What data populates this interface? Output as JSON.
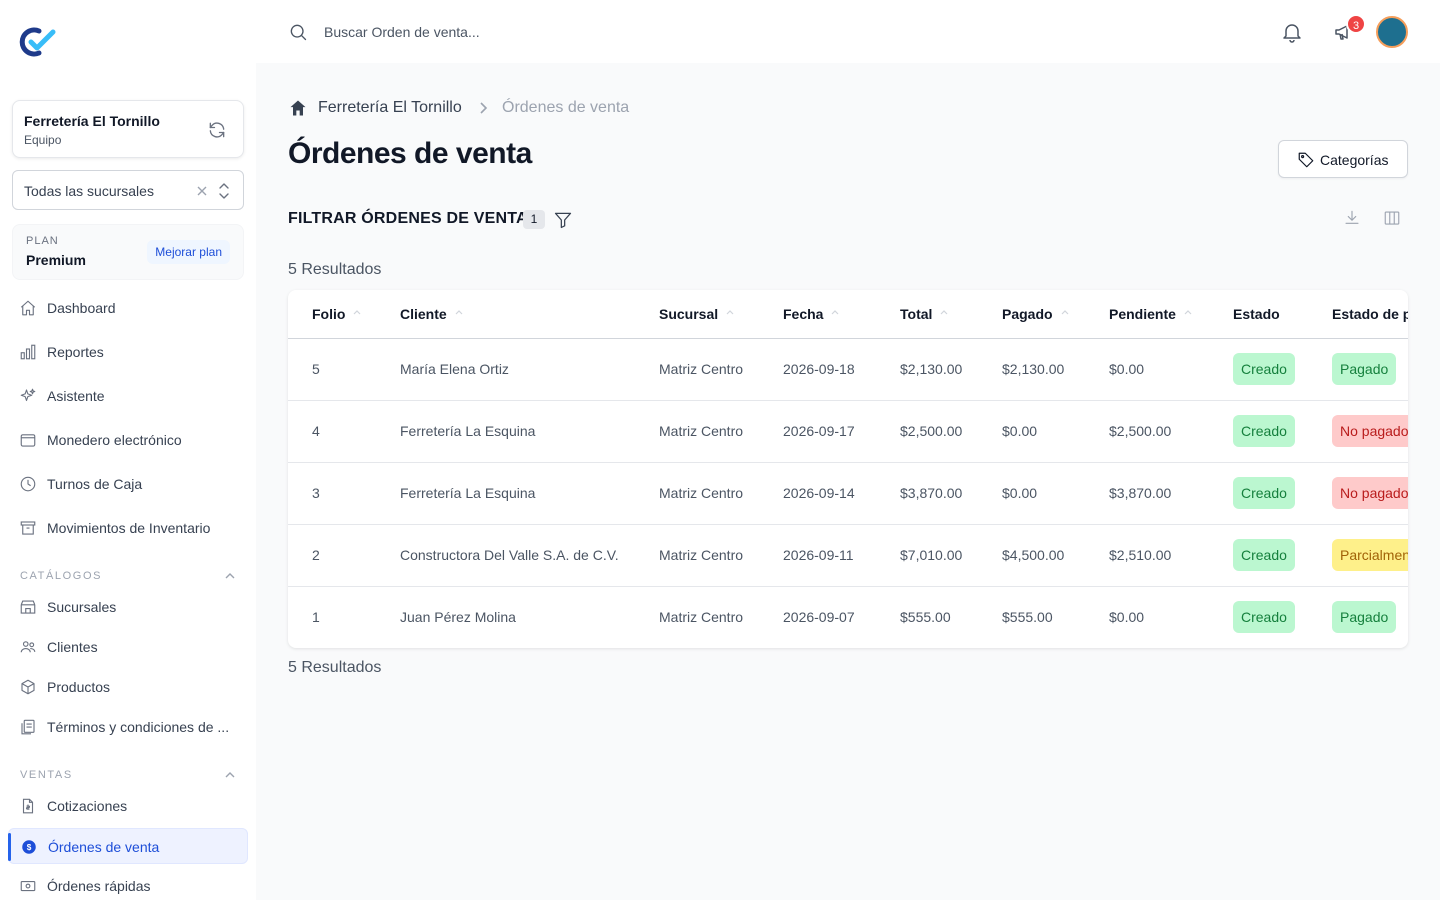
{
  "search": {
    "placeholder": "Buscar Orden de venta..."
  },
  "notifications": {
    "badge_count": "3"
  },
  "organization": {
    "name": "Ferretería El Tornillo",
    "subtitle": "Equipo"
  },
  "branch_select": {
    "value": "Todas las sucursales"
  },
  "plan": {
    "label": "PLAN",
    "name": "Premium",
    "upgrade_label": "Mejorar plan"
  },
  "sidebar": {
    "main_items": [
      {
        "label": "Dashboard",
        "icon": "home-icon"
      },
      {
        "label": "Reportes",
        "icon": "chart-icon"
      },
      {
        "label": "Asistente",
        "icon": "sparkles-icon"
      },
      {
        "label": "Monedero electrónico",
        "icon": "wallet-icon"
      },
      {
        "label": "Turnos de Caja",
        "icon": "clock-icon"
      },
      {
        "label": "Movimientos de Inventario",
        "icon": "archive-icon"
      }
    ],
    "catalogs_label": "CATÁLOGOS",
    "catalog_items": [
      {
        "label": "Sucursales",
        "icon": "store-icon"
      },
      {
        "label": "Clientes",
        "icon": "users-icon"
      },
      {
        "label": "Productos",
        "icon": "cube-icon"
      },
      {
        "label": "Términos y condiciones de ...",
        "icon": "documents-icon"
      }
    ],
    "sales_label": "VENTAS",
    "sales_items": [
      {
        "label": "Cotizaciones",
        "icon": "document-dollar-icon"
      },
      {
        "label": "Órdenes de venta",
        "icon": "dollar-circle-icon",
        "active": true
      },
      {
        "label": "Órdenes rápidas",
        "icon": "cash-icon"
      }
    ]
  },
  "breadcrumb": {
    "root": "Ferretería El Tornillo",
    "current": "Órdenes de venta"
  },
  "page": {
    "title": "Órdenes de venta",
    "categories_button": "Categorías",
    "filter_title": "FILTRAR ÓRDENES DE VENTA",
    "filter_count": "1",
    "results_label": "5 Resultados"
  },
  "table": {
    "columns": [
      "Folio",
      "Cliente",
      "Sucursal",
      "Fecha",
      "Total",
      "Pagado",
      "Pendiente",
      "Estado",
      "Estado de pago"
    ],
    "rows": [
      {
        "folio": "5",
        "cliente": "María Elena Ortiz",
        "sucursal": "Matriz Centro",
        "fecha": "2026-09-18",
        "total": "$2,130.00",
        "pagado": "$2,130.00",
        "pendiente": "$0.00",
        "estado": "Creado",
        "estado_pago": "Pagado",
        "pago_color": "green"
      },
      {
        "folio": "4",
        "cliente": "Ferretería La Esquina",
        "sucursal": "Matriz Centro",
        "fecha": "2026-09-17",
        "total": "$2,500.00",
        "pagado": "$0.00",
        "pendiente": "$2,500.00",
        "estado": "Creado",
        "estado_pago": "No pagado",
        "pago_color": "red"
      },
      {
        "folio": "3",
        "cliente": "Ferretería La Esquina",
        "sucursal": "Matriz Centro",
        "fecha": "2026-09-14",
        "total": "$3,870.00",
        "pagado": "$0.00",
        "pendiente": "$3,870.00",
        "estado": "Creado",
        "estado_pago": "No pagado",
        "pago_color": "red"
      },
      {
        "folio": "2",
        "cliente": "Constructora Del Valle S.A. de C.V.",
        "sucursal": "Matriz Centro",
        "fecha": "2026-09-11",
        "total": "$7,010.00",
        "pagado": "$4,500.00",
        "pendiente": "$2,510.00",
        "estado": "Creado",
        "estado_pago": "Parcialmente pagado",
        "pago_color": "yellow"
      },
      {
        "folio": "1",
        "cliente": "Juan Pérez Molina",
        "sucursal": "Matriz Centro",
        "fecha": "2026-09-07",
        "total": "$555.00",
        "pagado": "$555.00",
        "pendiente": "$0.00",
        "estado": "Creado",
        "estado_pago": "Pagado",
        "pago_color": "green"
      }
    ]
  },
  "colors": {
    "accent": "#2563eb",
    "paid": "#bbf7d0",
    "unpaid": "#fecaca",
    "partial": "#fef08a",
    "avatar": "#1e6f8f"
  }
}
